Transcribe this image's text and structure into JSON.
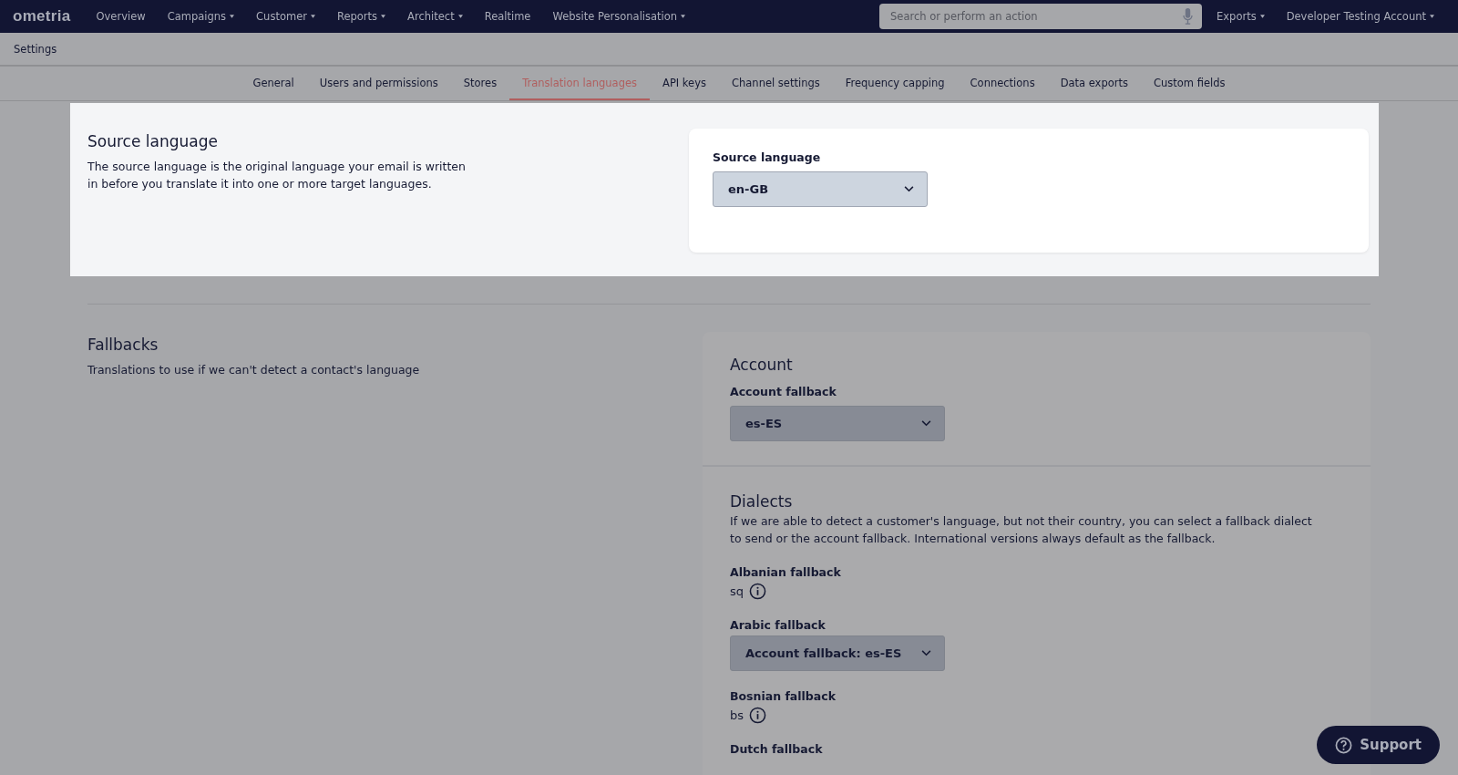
{
  "nav": {
    "logo": "ometria",
    "items": [
      {
        "label": "Overview",
        "dropdown": false
      },
      {
        "label": "Campaigns",
        "dropdown": true
      },
      {
        "label": "Customer",
        "dropdown": true
      },
      {
        "label": "Reports",
        "dropdown": true
      },
      {
        "label": "Architect",
        "dropdown": true
      },
      {
        "label": "Realtime",
        "dropdown": false
      },
      {
        "label": "Website Personalisation",
        "dropdown": true
      }
    ],
    "search": {
      "placeholder": "Search or perform an action"
    },
    "right_items": [
      {
        "label": "Exports",
        "dropdown": true
      },
      {
        "label": "Developer Testing Account",
        "dropdown": true
      }
    ]
  },
  "page_title": "Settings",
  "tabs": [
    {
      "label": "General",
      "selected": false
    },
    {
      "label": "Users and permissions",
      "selected": false
    },
    {
      "label": "Stores",
      "selected": false
    },
    {
      "label": "Translation languages",
      "selected": true
    },
    {
      "label": "API keys",
      "selected": false
    },
    {
      "label": "Channel settings",
      "selected": false
    },
    {
      "label": "Frequency capping",
      "selected": false
    },
    {
      "label": "Connections",
      "selected": false
    },
    {
      "label": "Data exports",
      "selected": false
    },
    {
      "label": "Custom fields",
      "selected": false
    }
  ],
  "source_language": {
    "title": "Source language",
    "description": "The source language is the original language your email is written in before you translate it into one or more target languages.",
    "field_label": "Source language",
    "value": "en-GB"
  },
  "fallbacks": {
    "title": "Fallbacks",
    "description": "Translations to use if we can't detect a contact's language",
    "account": {
      "title": "Account",
      "field_label": "Account fallback",
      "value": "es-ES"
    },
    "dialects": {
      "title": "Dialects",
      "description": "If we are able to detect a customer's language, but not their country, you can select a fallback dialect to send or the account fallback. International versions always default as the fallback.",
      "items": [
        {
          "kind": "code",
          "label": "Albanian fallback",
          "value": "sq"
        },
        {
          "kind": "select",
          "label": "Arabic fallback",
          "value": "Account fallback: es-ES"
        },
        {
          "kind": "code",
          "label": "Bosnian fallback",
          "value": "bs"
        },
        {
          "kind": "label",
          "label": "Dutch fallback"
        }
      ]
    }
  },
  "support_button": "Support"
}
